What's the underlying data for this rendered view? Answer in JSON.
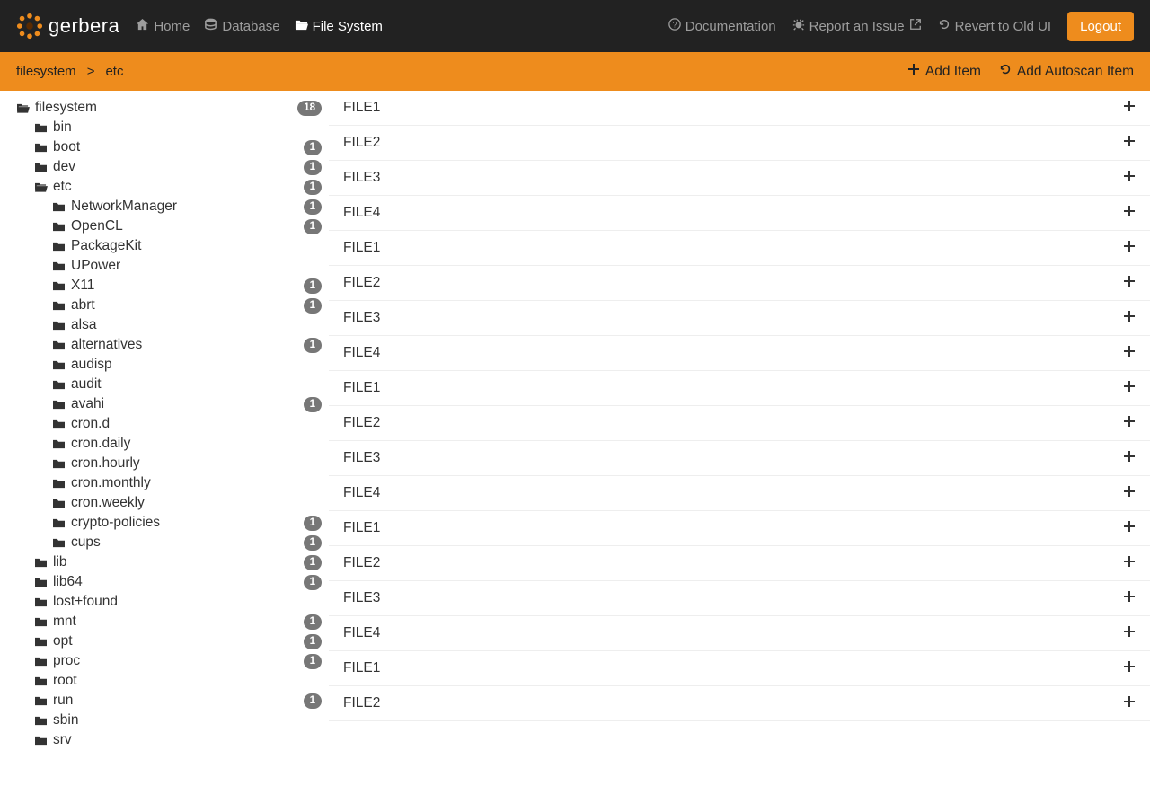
{
  "brand": "gerbera",
  "nav": {
    "home": "Home",
    "database": "Database",
    "filesystem": "File System",
    "documentation": "Documentation",
    "report": "Report an Issue",
    "revert": "Revert to Old UI",
    "logout": "Logout"
  },
  "breadcrumb": {
    "root": "filesystem",
    "child": "etc"
  },
  "toolbar": {
    "add_item": "Add Item",
    "add_autoscan": "Add Autoscan Item"
  },
  "tree": {
    "label": "filesystem",
    "badge": "18",
    "children": [
      {
        "label": "bin",
        "badge": null
      },
      {
        "label": "boot",
        "badge": "1"
      },
      {
        "label": "dev",
        "badge": "1"
      },
      {
        "label": "etc",
        "badge": "1",
        "open": true,
        "children": [
          {
            "label": "NetworkManager",
            "badge": "1"
          },
          {
            "label": "OpenCL",
            "badge": "1"
          },
          {
            "label": "PackageKit",
            "badge": null
          },
          {
            "label": "UPower",
            "badge": null
          },
          {
            "label": "X11",
            "badge": "1"
          },
          {
            "label": "abrt",
            "badge": "1"
          },
          {
            "label": "alsa",
            "badge": null
          },
          {
            "label": "alternatives",
            "badge": "1"
          },
          {
            "label": "audisp",
            "badge": null
          },
          {
            "label": "audit",
            "badge": null
          },
          {
            "label": "avahi",
            "badge": "1"
          },
          {
            "label": "cron.d",
            "badge": null
          },
          {
            "label": "cron.daily",
            "badge": null
          },
          {
            "label": "cron.hourly",
            "badge": null
          },
          {
            "label": "cron.monthly",
            "badge": null
          },
          {
            "label": "cron.weekly",
            "badge": null
          },
          {
            "label": "crypto-policies",
            "badge": "1"
          },
          {
            "label": "cups",
            "badge": "1"
          }
        ]
      },
      {
        "label": "lib",
        "badge": "1"
      },
      {
        "label": "lib64",
        "badge": "1"
      },
      {
        "label": "lost+found",
        "badge": null
      },
      {
        "label": "mnt",
        "badge": "1"
      },
      {
        "label": "opt",
        "badge": "1"
      },
      {
        "label": "proc",
        "badge": "1"
      },
      {
        "label": "root",
        "badge": null
      },
      {
        "label": "run",
        "badge": "1"
      },
      {
        "label": "sbin",
        "badge": null
      },
      {
        "label": "srv",
        "badge": null
      }
    ]
  },
  "files": [
    "FILE1",
    "FILE2",
    "FILE3",
    "FILE4",
    "FILE1",
    "FILE2",
    "FILE3",
    "FILE4",
    "FILE1",
    "FILE2",
    "FILE3",
    "FILE4",
    "FILE1",
    "FILE2",
    "FILE3",
    "FILE4",
    "FILE1",
    "FILE2"
  ]
}
